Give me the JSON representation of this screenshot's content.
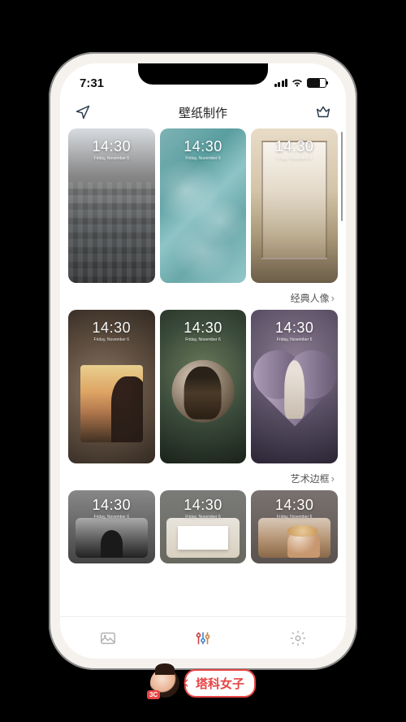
{
  "status": {
    "time": "7:31"
  },
  "header": {
    "title": "壁纸制作",
    "left_icon": "send-icon",
    "right_icon": "crown-icon"
  },
  "preview": {
    "time": "14:30",
    "date": "Friday, November 6"
  },
  "sections": [
    {
      "label": "经典人像"
    },
    {
      "label": "艺术边框"
    }
  ],
  "tabs": {
    "gallery": "gallery-icon",
    "adjust": "sliders-icon",
    "settings": "gear-icon"
  },
  "watermark": {
    "badge": "3C",
    "text": "塔科女子"
  }
}
